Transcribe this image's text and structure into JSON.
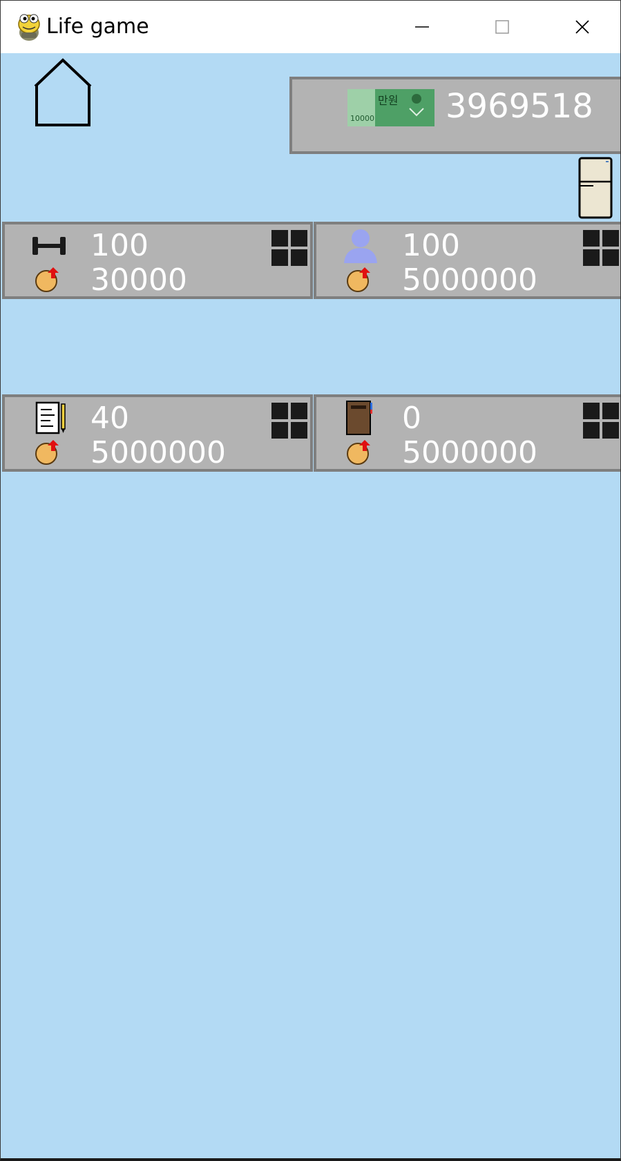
{
  "window": {
    "title": "Life game",
    "icon": "python-snake-icon",
    "controls": [
      "minimize",
      "maximize",
      "close"
    ]
  },
  "game": {
    "background_color": "#b3daf4",
    "money": {
      "icon": "banknote-icon",
      "bill_text": "만원",
      "bill_number": "10000",
      "amount": "3969518"
    },
    "cards": [
      {
        "stat_icon": "dumbbell-icon",
        "stat_value": "100",
        "cost_icon": "coin-upgrade-icon",
        "cost": "30000"
      },
      {
        "stat_icon": "person-icon",
        "stat_value": "100",
        "cost_icon": "coin-upgrade-icon",
        "cost": "5000000"
      },
      {
        "stat_icon": "notepad-pencil-icon",
        "stat_value": "40",
        "cost_icon": "coin-upgrade-icon",
        "cost": "5000000"
      },
      {
        "stat_icon": "book-icon",
        "stat_value": "0",
        "cost_icon": "coin-upgrade-icon",
        "cost": "5000000"
      }
    ],
    "colors": {
      "panel_fill": "#b3b3b3",
      "panel_border": "#7f7f7f",
      "text": "#ffffff"
    }
  }
}
